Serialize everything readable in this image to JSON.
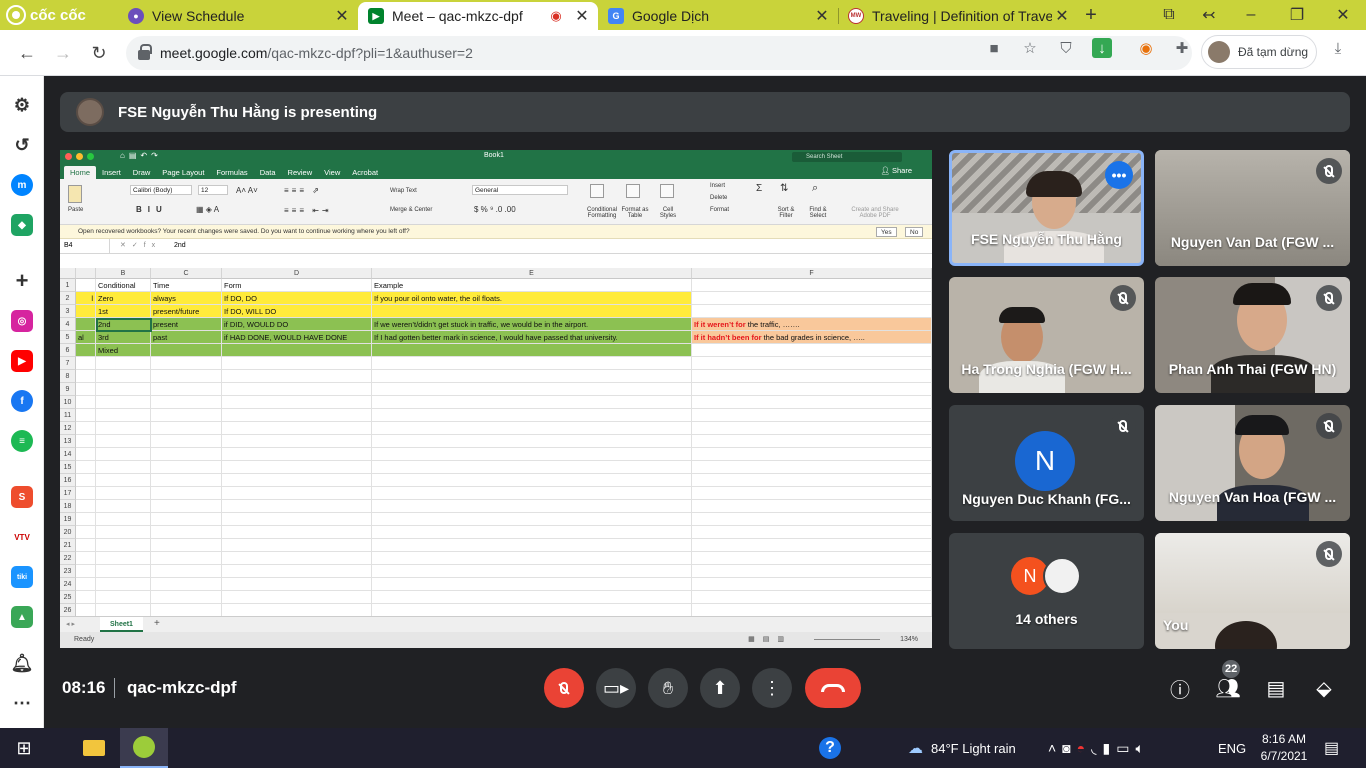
{
  "browser": {
    "brand": "cốc cốc",
    "tabs": [
      {
        "title": "View Schedule",
        "favicon": "schedule-icon"
      },
      {
        "title": "Meet – qac-mkzc-dpf",
        "favicon": "meet-icon",
        "active": true
      },
      {
        "title": "Google Dịch",
        "favicon": "translate-icon"
      },
      {
        "title": "Traveling | Definition of Trave",
        "favicon": "merriam-webster-icon"
      }
    ],
    "url_host": "meet.google.com",
    "url_path": "/qac-mkzc-dpf?pli=1&authuser=2",
    "profile_status": "Đã tạm dừng",
    "brand_color": "#c9d33a"
  },
  "meet": {
    "presenting_banner": "FSE Nguyễn Thu Hằng is presenting",
    "time": "08:16",
    "meeting_code": "qac-mkzc-dpf",
    "people_count": "22",
    "participants": [
      {
        "name": "FSE Nguyễn Thu Hằng",
        "active_speaker": true
      },
      {
        "name": "Nguyen Van Dat (FGW ..."
      },
      {
        "name": "Ha Trong Nghia (FGW H..."
      },
      {
        "name": "Phan Anh Thai (FGW HN)"
      },
      {
        "name": "Nguyen Duc Khanh (FG...",
        "initial": "N"
      },
      {
        "name": "Nguyen Van Hoa (FGW ..."
      },
      {
        "name": "14 others",
        "initial": "N"
      },
      {
        "name": "You"
      }
    ]
  },
  "excel": {
    "book_name": "Book1",
    "search_placeholder": "Search Sheet",
    "menu": [
      "Home",
      "Insert",
      "Draw",
      "Page Layout",
      "Formulas",
      "Data",
      "Review",
      "View",
      "Acrobat"
    ],
    "share": "Share",
    "ribbon": {
      "paste": "Paste",
      "font": "Calibri (Body)",
      "size": "12",
      "wrap_text": "Wrap Text",
      "merge_center": "Merge & Center",
      "number_format": "General",
      "conditional_formatting": "Conditional Formatting",
      "format_as_table": "Format as Table",
      "cell_styles": "Cell Styles",
      "insert": "Insert",
      "delete": "Delete",
      "format": "Format",
      "sort_filter": "Sort & Filter",
      "find_select": "Find & Select",
      "create_share": "Create and Share Adobe PDF"
    },
    "message": "Open recovered workbooks?  Your recent changes were saved. Do you want to continue working where you left off?",
    "message_yes": "Yes",
    "message_no": "No",
    "name_box": "B4",
    "formula_value": "2nd",
    "columns": [
      "B",
      "C",
      "D",
      "E",
      "F"
    ],
    "rows": [
      "1",
      "2",
      "3",
      "4",
      "5",
      "6",
      "7",
      "8",
      "9",
      "10",
      "11",
      "12",
      "13",
      "14",
      "15",
      "16",
      "17",
      "18",
      "19",
      "20",
      "21",
      "22",
      "23",
      "24",
      "25",
      "26"
    ],
    "table": {
      "header": {
        "b": "Conditional",
        "c": "Time",
        "d": "Form",
        "e": "Example"
      },
      "r2": {
        "a": "l",
        "b": "Zero",
        "c": "always",
        "d": "If DO, DO",
        "e": "If you pour oil onto water, the oil floats."
      },
      "r3": {
        "b": "1st",
        "c": "present/future",
        "d": "If DO, WILL DO"
      },
      "r4": {
        "b": "2nd",
        "c": "present",
        "d": "if DID, WOULD DO",
        "e": "If we weren’t/didn’t get stuck in traffic, we would be in the airport.",
        "f_red": "If it weren’t for",
        "f_rest": " the traffic, ……."
      },
      "r5": {
        "a": "al",
        "b": "3rd",
        "c": "past",
        "d": "if HAD DONE, WOULD HAVE DONE",
        "e": "If I had gotten better mark in science, I would have passed that university.",
        "f_red": "If it hadn’t been for",
        "f_rest": " the bad grades in science, ….."
      },
      "r6": {
        "b": "Mixed"
      }
    },
    "sheet_tab": "Sheet1",
    "status": "Ready",
    "zoom": "134%",
    "colors": {
      "excel_green": "#217346",
      "yellow": "#ffeb3b",
      "green": "#8cc152",
      "peach": "#f9c89b"
    }
  },
  "taskbar": {
    "weather": "84°F  Light rain",
    "lang": "ENG",
    "time": "8:16 AM",
    "date": "6/7/2021"
  }
}
